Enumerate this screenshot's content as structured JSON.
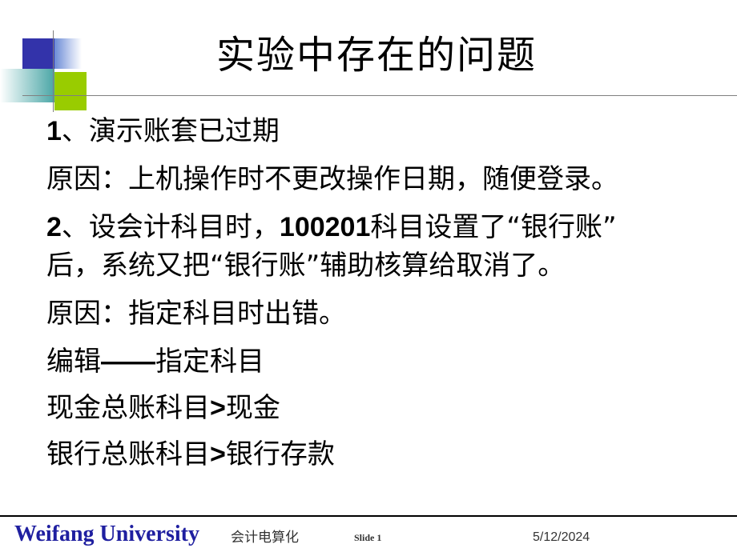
{
  "slide": {
    "title": "实验中存在的问题",
    "lines": [
      {
        "prefix": "1",
        "text": "、演示账套已过期"
      },
      {
        "prefix": "",
        "text": "原因：上机操作时不更改操作日期，随便登录。"
      },
      {
        "prefix": "2",
        "text": "、设会计科目时，",
        "bold_mid": "100201",
        "text2": "科目设置了“银行账”"
      },
      {
        "prefix": "",
        "text": "后，系统又把“银行账”辅助核算给取消了。"
      },
      {
        "prefix": "",
        "text": "原因：指定科目时出错。"
      },
      {
        "prefix": "",
        "text": "编辑",
        "bold_mid": "——",
        "text2": "指定科目"
      },
      {
        "prefix": "",
        "text": "现金总账科目",
        "bold_mid": ">",
        "text2": "现金"
      },
      {
        "prefix": "",
        "text": "银行总账科目",
        "bold_mid": ">",
        "text2": "银行存款"
      }
    ]
  },
  "footer": {
    "university": "Weifang University",
    "course": "会计电算化",
    "slide_label": "Slide 1",
    "date": "5/12/2024"
  },
  "colors": {
    "footer_university": "#1f1fa0",
    "accent_blue": "#3333aa",
    "accent_green": "#99cc00",
    "accent_teal": "#4aa6a6"
  }
}
